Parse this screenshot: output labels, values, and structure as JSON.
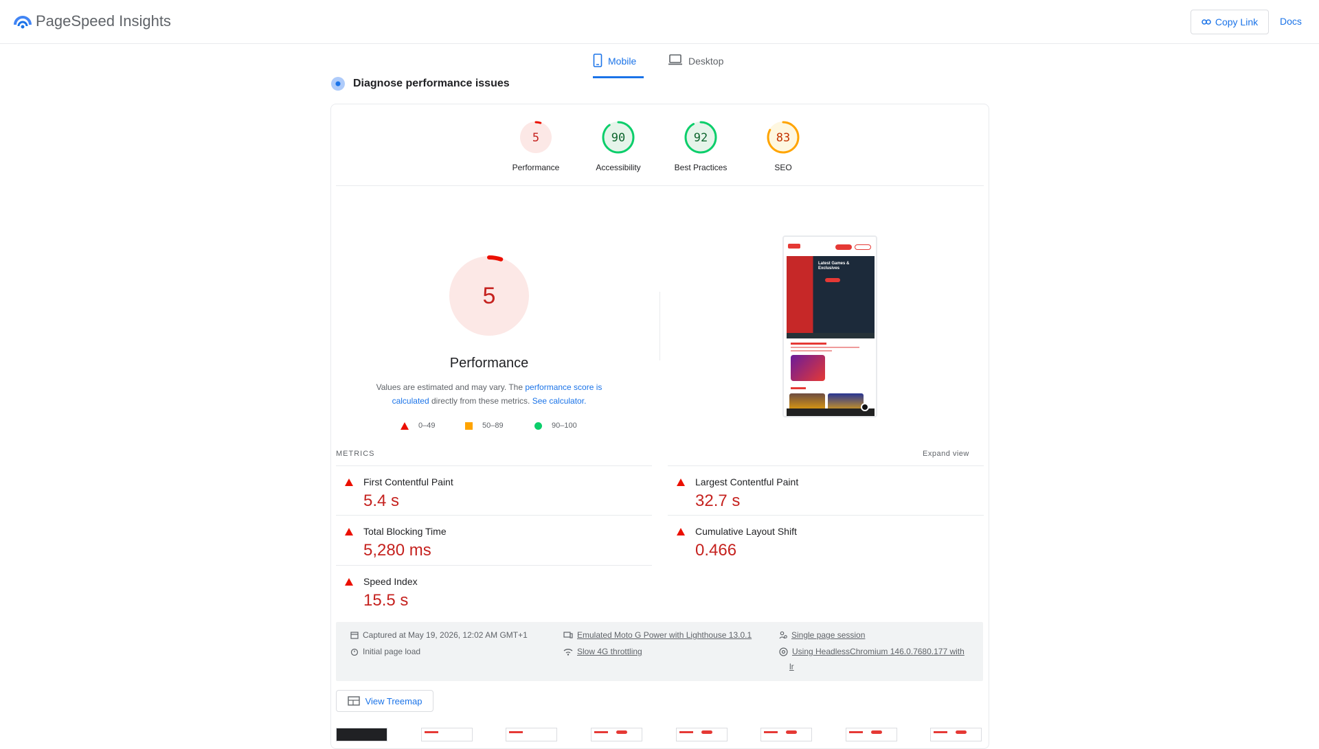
{
  "header": {
    "app_title": "PageSpeed Insights",
    "copy_link": "Copy Link",
    "docs": "Docs"
  },
  "tabs": {
    "mobile": "Mobile",
    "desktop": "Desktop",
    "selected": "Mobile"
  },
  "diagnose_title": "Diagnose performance issues",
  "scores": [
    {
      "label": "Performance",
      "value": "5",
      "score": 5,
      "color": "#eb0f00",
      "fill": "#fce8e6"
    },
    {
      "label": "Accessibility",
      "value": "90",
      "score": 90,
      "color": "#0cce6b",
      "fill": "#e6f4ea"
    },
    {
      "label": "Best Practices",
      "value": "92",
      "score": 92,
      "color": "#0cce6b",
      "fill": "#e6f4ea"
    },
    {
      "label": "SEO",
      "value": "83",
      "score": 83,
      "color": "#ffa400",
      "fill": "#fef7e0"
    }
  ],
  "performance": {
    "score": "5",
    "score_value": 5,
    "label": "Performance",
    "note_prefix": "Values are estimated and may vary. The ",
    "note_link1": "performance score is calculated",
    "note_middle": " directly from these metrics. ",
    "note_link2": "See calculator."
  },
  "legend": {
    "fail": "0–49",
    "average": "50–89",
    "pass": "90–100"
  },
  "phone_preview": {
    "hero_text": "Latest Games & Exclusives"
  },
  "metrics": {
    "title": "METRICS",
    "expand": "Expand view",
    "fcp": {
      "label": "First Contentful Paint",
      "value": "5.4 s"
    },
    "lcp": {
      "label": "Largest Contentful Paint",
      "value": "32.7 s"
    },
    "tbt": {
      "label": "Total Blocking Time",
      "value": "5,280 ms"
    },
    "cls": {
      "label": "Cumulative Layout Shift",
      "value": "0.466"
    },
    "si": {
      "label": "Speed Index",
      "value": "15.5 s"
    }
  },
  "info": {
    "captured": "Captured at May 19, 2026, 12:02 AM GMT+1",
    "initial_load": "Initial page load",
    "device": "Emulated Moto G Power with Lighthouse 13.0.1",
    "throttling": "Slow 4G throttling",
    "session": "Single page session",
    "browser": "Using HeadlessChromium 146.0.7680.177 with",
    "browser_cont": "lr"
  },
  "treemap_button": "View Treemap",
  "colors": {
    "accent": "#1a73e8",
    "fail": "#eb0f00",
    "average": "#ffa400",
    "pass": "#0cce6b"
  }
}
